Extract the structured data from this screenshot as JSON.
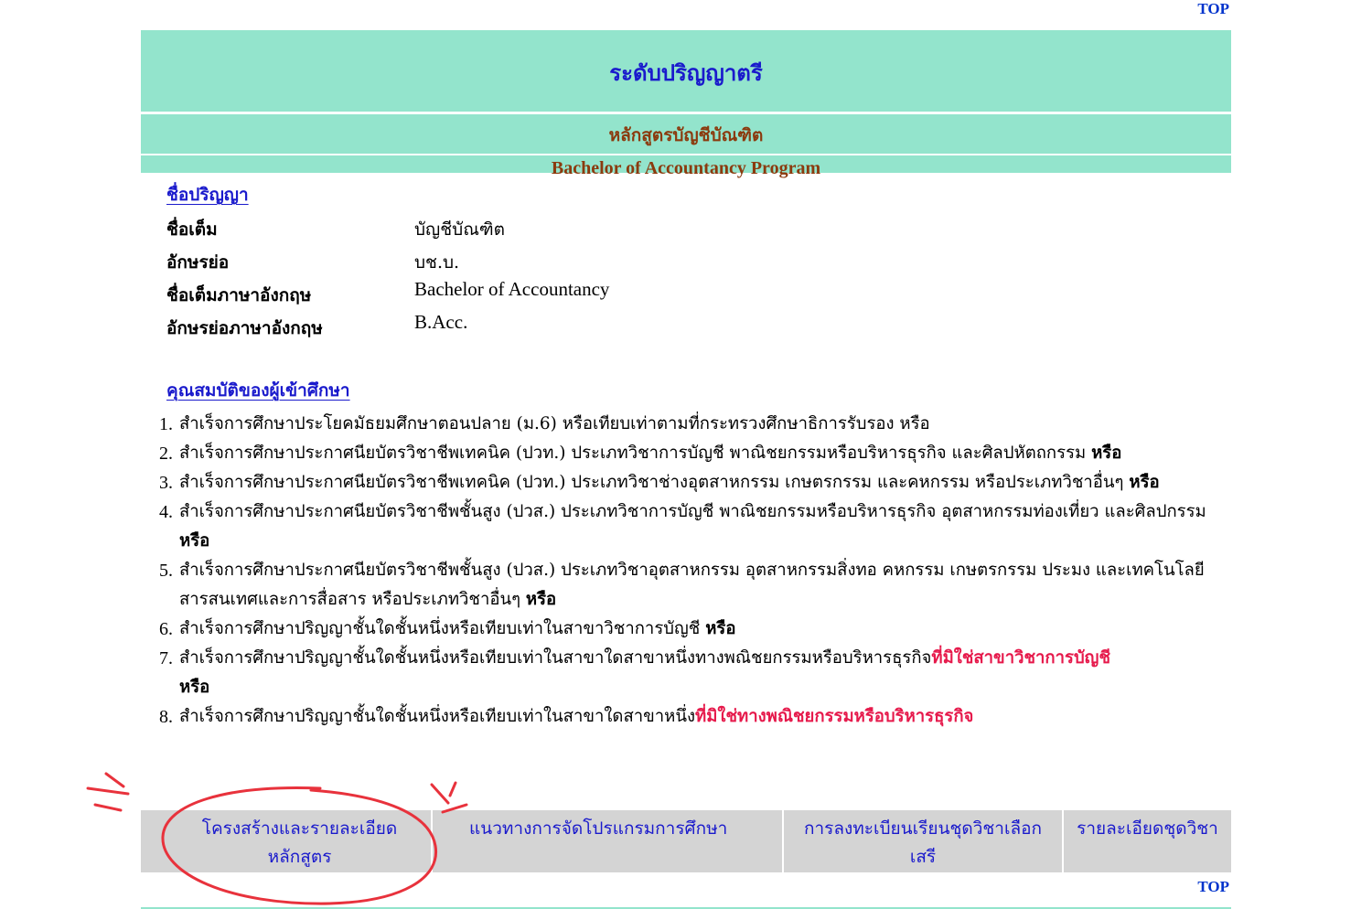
{
  "top_link_label": "TOP",
  "header": {
    "title": "ระดับปริญญาตรี",
    "program_thai": "หลักสูตรบัญชีบัณฑิต",
    "program_eng": "Bachelor of Accountancy Program"
  },
  "degree": {
    "heading": "ชื่อปริญญา",
    "rows": [
      {
        "label": "ชื่อเต็ม",
        "value": "บัญชีบัณฑิต"
      },
      {
        "label": "อักษรย่อ",
        "value": "บช.บ."
      },
      {
        "label": "ชื่อเต็มภาษาอังกฤษ",
        "value": "Bachelor of Accountancy"
      },
      {
        "label": "อักษรย่อภาษาอังกฤษ",
        "value": "B.Acc."
      }
    ]
  },
  "qualifications": {
    "heading": "คุณสมบัติของผู้เข้าศึกษา",
    "items": [
      {
        "num": "1.",
        "text": "สำเร็จการศึกษาประโยคมัธยมศึกษาตอนปลาย (ม.6) หรือเทียบเท่าตามที่กระทรวงศึกษาธิการรับรอง หรือ",
        "bold": "",
        "red": ""
      },
      {
        "num": "2.",
        "text": "สำเร็จการศึกษาประกาศนียบัตรวิชาชีพเทคนิค (ปวท.) ประเภทวิชาการบัญชี พาณิชยกรรมหรือบริหารธุรกิจ และศิลปหัตถกรรม ",
        "bold": "หรือ",
        "red": ""
      },
      {
        "num": "3.",
        "text": "สำเร็จการศึกษาประกาศนียบัตรวิชาชีพเทคนิค (ปวท.) ประเภทวิชาช่างอุตสาหกรรม เกษตรกรรม และคหกรรม หรือประเภทวิชาอื่นๆ ",
        "bold": "หรือ",
        "red": ""
      },
      {
        "num": "4.",
        "text": "สำเร็จการศึกษาประกาศนียบัตรวิชาชีพชั้นสูง (ปวส.) ประเภทวิชาการบัญชี พาณิชยกรรมหรือบริหารธุรกิจ อุตสาหกรรมท่องเที่ยว และศิลปกรรม ",
        "bold": "หรือ",
        "red": ""
      },
      {
        "num": "5.",
        "text": "สำเร็จการศึกษาประกาศนียบัตรวิชาชีพชั้นสูง (ปวส.) ประเภทวิชาอุตสาหกรรม อุตสาหกรรมสิ่งทอ คหกรรม เกษตรกรรม ประมง และเทคโนโลยีสารสนเทศและการสื่อสาร หรือประเภทวิชาอื่นๆ ",
        "bold": "หรือ",
        "red": ""
      },
      {
        "num": "6.",
        "text": "สำเร็จการศึกษาปริญญาชั้นใดชั้นหนึ่งหรือเทียบเท่าในสาขาวิชาการบัญชี ",
        "bold": "หรือ",
        "red": ""
      },
      {
        "num": "7.",
        "text": "สำเร็จการศึกษาปริญญาชั้นใดชั้นหนึ่งหรือเทียบเท่าในสาขาใดสาขาหนึ่งทางพณิชยกรรมหรือบริหารธุรกิจ",
        "red": "ที่มิใช่สาขาวิชาการบัญชี",
        "bold": "หรือ"
      },
      {
        "num": "8.",
        "text": "สำเร็จการศึกษาปริญญาชั้นใดชั้นหนึ่งหรือเทียบเท่าในสาขาใดสาขาหนึ่ง",
        "red": "ที่มิใช่ทางพณิชยกรรมหรือบริหารธุรกิจ",
        "bold": ""
      }
    ]
  },
  "nav": [
    "โครงสร้างและรายละเอียดหลักสูตร",
    "แนวทางการจัดโปรแกรมการศึกษา",
    "การลงทะเบียนเรียนชุดวิชาเลือกเสรี",
    "รายละเอียดชุดวิชา"
  ],
  "colors": {
    "band": "#93e4cc",
    "link_blue": "#1a1acc",
    "program_brown": "#8b3a0e",
    "highlight_red": "#e6194b",
    "nav_gray": "#d4d4d4",
    "annotation_red": "#e8323c"
  }
}
